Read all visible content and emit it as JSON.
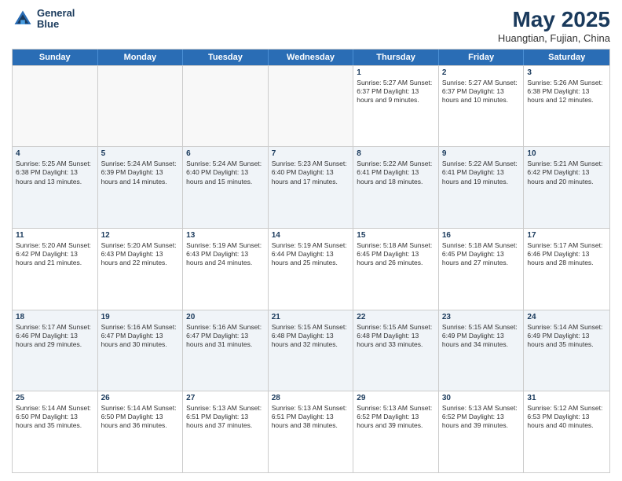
{
  "header": {
    "logo_line1": "General",
    "logo_line2": "Blue",
    "month": "May 2025",
    "location": "Huangtian, Fujian, China"
  },
  "days_of_week": [
    "Sunday",
    "Monday",
    "Tuesday",
    "Wednesday",
    "Thursday",
    "Friday",
    "Saturday"
  ],
  "weeks": [
    [
      {
        "day": "",
        "info": "",
        "empty": true
      },
      {
        "day": "",
        "info": "",
        "empty": true
      },
      {
        "day": "",
        "info": "",
        "empty": true
      },
      {
        "day": "",
        "info": "",
        "empty": true
      },
      {
        "day": "1",
        "info": "Sunrise: 5:27 AM\nSunset: 6:37 PM\nDaylight: 13 hours\nand 9 minutes."
      },
      {
        "day": "2",
        "info": "Sunrise: 5:27 AM\nSunset: 6:37 PM\nDaylight: 13 hours\nand 10 minutes."
      },
      {
        "day": "3",
        "info": "Sunrise: 5:26 AM\nSunset: 6:38 PM\nDaylight: 13 hours\nand 12 minutes."
      }
    ],
    [
      {
        "day": "4",
        "info": "Sunrise: 5:25 AM\nSunset: 6:38 PM\nDaylight: 13 hours\nand 13 minutes."
      },
      {
        "day": "5",
        "info": "Sunrise: 5:24 AM\nSunset: 6:39 PM\nDaylight: 13 hours\nand 14 minutes."
      },
      {
        "day": "6",
        "info": "Sunrise: 5:24 AM\nSunset: 6:40 PM\nDaylight: 13 hours\nand 15 minutes."
      },
      {
        "day": "7",
        "info": "Sunrise: 5:23 AM\nSunset: 6:40 PM\nDaylight: 13 hours\nand 17 minutes."
      },
      {
        "day": "8",
        "info": "Sunrise: 5:22 AM\nSunset: 6:41 PM\nDaylight: 13 hours\nand 18 minutes."
      },
      {
        "day": "9",
        "info": "Sunrise: 5:22 AM\nSunset: 6:41 PM\nDaylight: 13 hours\nand 19 minutes."
      },
      {
        "day": "10",
        "info": "Sunrise: 5:21 AM\nSunset: 6:42 PM\nDaylight: 13 hours\nand 20 minutes."
      }
    ],
    [
      {
        "day": "11",
        "info": "Sunrise: 5:20 AM\nSunset: 6:42 PM\nDaylight: 13 hours\nand 21 minutes."
      },
      {
        "day": "12",
        "info": "Sunrise: 5:20 AM\nSunset: 6:43 PM\nDaylight: 13 hours\nand 22 minutes."
      },
      {
        "day": "13",
        "info": "Sunrise: 5:19 AM\nSunset: 6:43 PM\nDaylight: 13 hours\nand 24 minutes."
      },
      {
        "day": "14",
        "info": "Sunrise: 5:19 AM\nSunset: 6:44 PM\nDaylight: 13 hours\nand 25 minutes."
      },
      {
        "day": "15",
        "info": "Sunrise: 5:18 AM\nSunset: 6:45 PM\nDaylight: 13 hours\nand 26 minutes."
      },
      {
        "day": "16",
        "info": "Sunrise: 5:18 AM\nSunset: 6:45 PM\nDaylight: 13 hours\nand 27 minutes."
      },
      {
        "day": "17",
        "info": "Sunrise: 5:17 AM\nSunset: 6:46 PM\nDaylight: 13 hours\nand 28 minutes."
      }
    ],
    [
      {
        "day": "18",
        "info": "Sunrise: 5:17 AM\nSunset: 6:46 PM\nDaylight: 13 hours\nand 29 minutes."
      },
      {
        "day": "19",
        "info": "Sunrise: 5:16 AM\nSunset: 6:47 PM\nDaylight: 13 hours\nand 30 minutes."
      },
      {
        "day": "20",
        "info": "Sunrise: 5:16 AM\nSunset: 6:47 PM\nDaylight: 13 hours\nand 31 minutes."
      },
      {
        "day": "21",
        "info": "Sunrise: 5:15 AM\nSunset: 6:48 PM\nDaylight: 13 hours\nand 32 minutes."
      },
      {
        "day": "22",
        "info": "Sunrise: 5:15 AM\nSunset: 6:48 PM\nDaylight: 13 hours\nand 33 minutes."
      },
      {
        "day": "23",
        "info": "Sunrise: 5:15 AM\nSunset: 6:49 PM\nDaylight: 13 hours\nand 34 minutes."
      },
      {
        "day": "24",
        "info": "Sunrise: 5:14 AM\nSunset: 6:49 PM\nDaylight: 13 hours\nand 35 minutes."
      }
    ],
    [
      {
        "day": "25",
        "info": "Sunrise: 5:14 AM\nSunset: 6:50 PM\nDaylight: 13 hours\nand 35 minutes."
      },
      {
        "day": "26",
        "info": "Sunrise: 5:14 AM\nSunset: 6:50 PM\nDaylight: 13 hours\nand 36 minutes."
      },
      {
        "day": "27",
        "info": "Sunrise: 5:13 AM\nSunset: 6:51 PM\nDaylight: 13 hours\nand 37 minutes."
      },
      {
        "day": "28",
        "info": "Sunrise: 5:13 AM\nSunset: 6:51 PM\nDaylight: 13 hours\nand 38 minutes."
      },
      {
        "day": "29",
        "info": "Sunrise: 5:13 AM\nSunset: 6:52 PM\nDaylight: 13 hours\nand 39 minutes."
      },
      {
        "day": "30",
        "info": "Sunrise: 5:13 AM\nSunset: 6:52 PM\nDaylight: 13 hours\nand 39 minutes."
      },
      {
        "day": "31",
        "info": "Sunrise: 5:12 AM\nSunset: 6:53 PM\nDaylight: 13 hours\nand 40 minutes."
      }
    ]
  ]
}
